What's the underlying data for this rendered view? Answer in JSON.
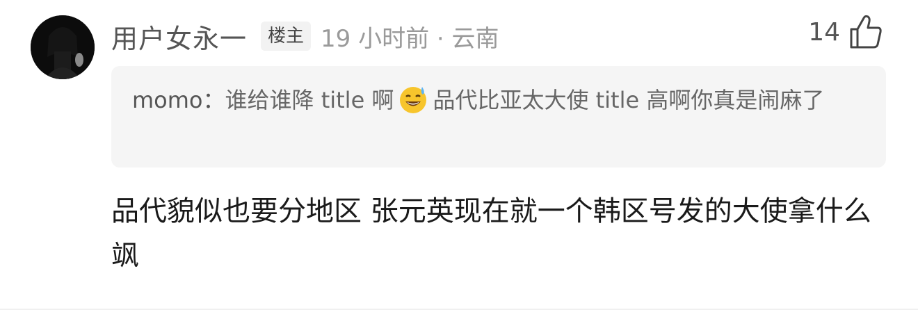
{
  "comment": {
    "username": "用户女永一",
    "op_badge": "楼主",
    "time_location": "19 小时前 · 云南",
    "like_count": "14",
    "like_icon": "thumbs-up-outline-icon",
    "quoted_reply": {
      "author": "momo：",
      "text_before_emoji": "谁给谁降 title 啊",
      "emoji": "sweat-smile-emoji",
      "text_after_emoji": "品代比亚太大使 title 高啊你真是闹麻了"
    },
    "body": "品代貌似也要分地区 张元英现在就一个韩区号发的大使拿什么飒"
  },
  "colors": {
    "username": "#555555",
    "meta": "#9a9a9a",
    "quote_bg": "#f5f5f5",
    "body_text": "#1a1a1a"
  }
}
